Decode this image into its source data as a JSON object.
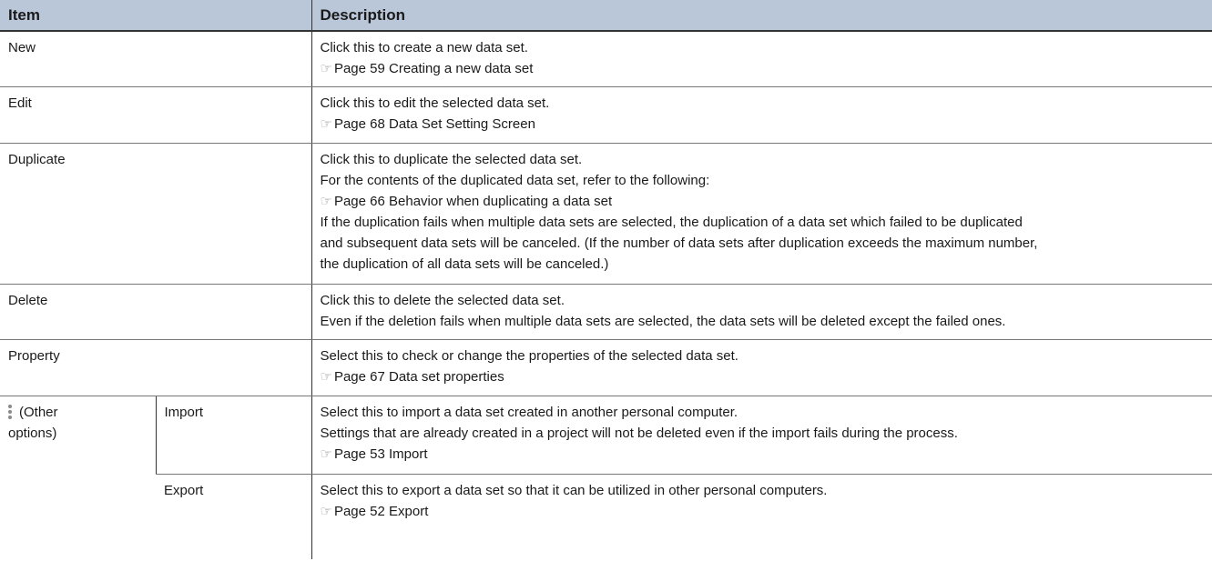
{
  "header": {
    "item": "Item",
    "description": "Description"
  },
  "ref_icon": "pointing-hand-icon",
  "rows": {
    "new": {
      "item": "New",
      "lines": [
        "Click this to create a new data set."
      ],
      "ref": "Page 59 Creating a new data set"
    },
    "edit": {
      "item": "Edit",
      "lines": [
        "Click this to edit the selected data set."
      ],
      "ref": "Page 68 Data Set Setting Screen"
    },
    "duplicate": {
      "item": "Duplicate",
      "lines": [
        "Click this to duplicate the selected data set.",
        "For the contents of the duplicated data set, refer to the following:"
      ],
      "ref": "Page 66 Behavior when duplicating a data set",
      "after": [
        "If the duplication fails when multiple data sets are selected, the duplication of a data set which failed to be duplicated",
        "and subsequent data sets will be canceled. (If the number of data sets after duplication exceeds the maximum number,",
        "the duplication of all data sets will be canceled.)"
      ]
    },
    "delete": {
      "item": "Delete",
      "lines": [
        "Click this to delete the selected data set.",
        "Even if the deletion fails when multiple data sets are selected, the data sets will be deleted except the failed ones."
      ]
    },
    "property": {
      "item": "Property",
      "lines": [
        "Select this to check or change the properties of the selected data set."
      ],
      "ref": "Page 67 Data set properties"
    },
    "other": {
      "item_line1": "(Other",
      "item_line2": "options)",
      "icon": "more-vertical-icon",
      "import": {
        "item": "Import",
        "lines": [
          "Select this to import a data set created in another personal computer.",
          "Settings that are already created in a project will not be deleted even if the import fails during the process."
        ],
        "ref": "Page 53 Import"
      },
      "export": {
        "item": "Export",
        "lines": [
          "Select this to export a data set so that it can be utilized in other personal computers."
        ],
        "ref": "Page 52 Export"
      }
    }
  }
}
